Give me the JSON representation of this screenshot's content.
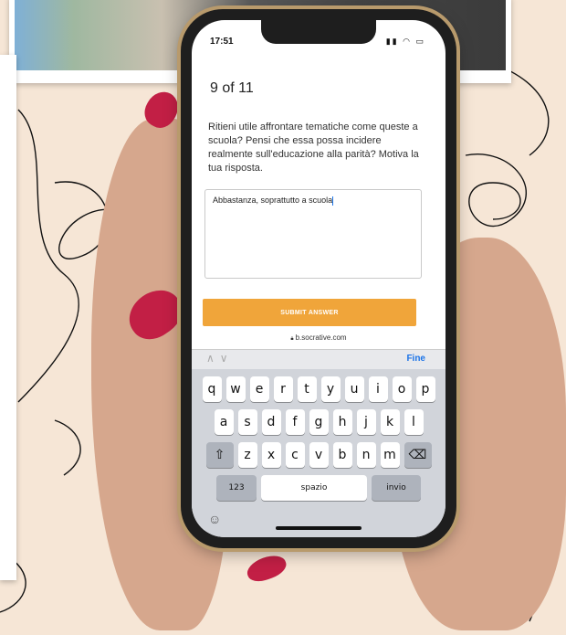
{
  "status": {
    "time": "17:51"
  },
  "quiz": {
    "progress": "9 of 11",
    "question": "Ritieni utile affrontare tematiche come queste a scuola? Pensi che essa possa incidere realmente sull'educazione alla parità? Motiva la tua risposta.",
    "answer": "Abbastanza, soprattutto a scuola",
    "submit_label": "SUBMIT ANSWER"
  },
  "browser": {
    "url": "b.socrative.com"
  },
  "keyboard": {
    "done_label": "Fine",
    "row1": [
      "q",
      "w",
      "e",
      "r",
      "t",
      "y",
      "u",
      "i",
      "o",
      "p"
    ],
    "row2": [
      "a",
      "s",
      "d",
      "f",
      "g",
      "h",
      "j",
      "k",
      "l"
    ],
    "row3": [
      "z",
      "x",
      "c",
      "v",
      "b",
      "n",
      "m"
    ],
    "numbers_label": "123",
    "space_label": "spazio",
    "return_label": "invio"
  },
  "icons": {
    "shift": "shift-icon",
    "backspace": "backspace-icon",
    "emoji": "emoji-icon",
    "lock": "lock-icon"
  },
  "colors": {
    "accent": "#f0a53a",
    "link": "#1a73e8",
    "nail": "#c21f45",
    "background": "#f6e6d6"
  }
}
